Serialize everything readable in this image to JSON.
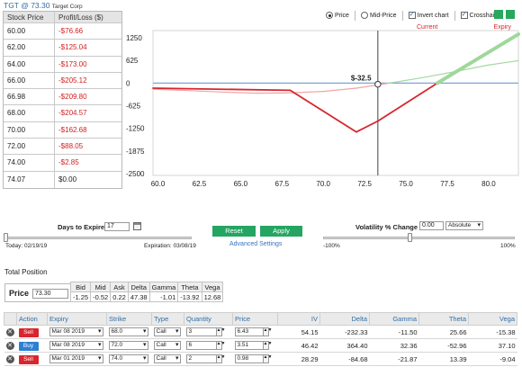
{
  "header": {
    "symbol": "TGT @ 73.30",
    "company": "Target Corp"
  },
  "pl_table": {
    "headers": [
      "Stock Price",
      "Profit/Loss ($)"
    ],
    "rows": [
      [
        "60.00",
        "-$76.66"
      ],
      [
        "62.00",
        "-$125.04"
      ],
      [
        "64.00",
        "-$173.00"
      ],
      [
        "66.00",
        "-$205.12"
      ],
      [
        "66.98",
        "-$209.80"
      ],
      [
        "68.00",
        "-$204.57"
      ],
      [
        "70.00",
        "-$162.68"
      ],
      [
        "72.00",
        "-$88.05"
      ],
      [
        "74.00",
        "-$2.85"
      ],
      [
        "74.07",
        "$0.00"
      ]
    ]
  },
  "options": {
    "price_label": "Price",
    "midprice_label": "Mid-Price",
    "invert_label": "Invert chart",
    "crosshairs_label": "Crosshairs",
    "price_selected": true,
    "invert_checked": true,
    "crosshairs_checked": true
  },
  "legend": {
    "current": "Current",
    "expiry": "Expiry"
  },
  "chart_data": {
    "type": "line",
    "x_ticks": [
      "60.0",
      "62.5",
      "65.0",
      "67.5",
      "70.0",
      "72.5",
      "75.0",
      "77.5",
      "80.0"
    ],
    "y_ticks": [
      "1250",
      "625",
      "0",
      "-625",
      "-1250",
      "-1875",
      "-2500"
    ],
    "xlim": [
      59.7,
      81.8
    ],
    "ylim": [
      -2550,
      1450
    ],
    "crosshair": {
      "x": 73.3,
      "y": -32.5,
      "label": "$-32.5"
    },
    "series": [
      {
        "name": "Current",
        "color": "#d7262e",
        "x": [
          59.7,
          62,
          64,
          66,
          68,
          70,
          72,
          74,
          76,
          78,
          80,
          81.8
        ],
        "y": [
          -170,
          -210,
          -250,
          -280,
          -270,
          -230,
          -140,
          0,
          150,
          320,
          500,
          620
        ]
      },
      {
        "name": "Expiry",
        "color": "#2a9f4b",
        "x": [
          59.7,
          68,
          72,
          73.3,
          76.9,
          81.8
        ],
        "y": [
          -140,
          -200,
          -1350,
          -1050,
          0,
          1350
        ]
      }
    ]
  },
  "days_to_expire": {
    "label": "Days to Expire",
    "value": "17",
    "today": "Today: 02/19/19",
    "expiration": "Expiration: 03/08/19"
  },
  "buttons": {
    "reset": "Reset",
    "apply": "Apply",
    "advanced": "Advanced Settings"
  },
  "volatility": {
    "label": "Volatility % Change",
    "value": "0.00",
    "mode": "Absolute",
    "min": "-100%",
    "max": "100%"
  },
  "total": {
    "title": "Total Position",
    "price_label": "Price",
    "price_value": "73.30",
    "greek_headers": [
      "Bid",
      "Mid",
      "Ask",
      "Delta",
      "Gamma",
      "Theta",
      "Vega"
    ],
    "greek_values": [
      "-1.25",
      "-0.52",
      "0.22",
      "47.38",
      "-1.01",
      "-13.92",
      "12.68"
    ]
  },
  "legs": {
    "headers": [
      "Action",
      "Expiry",
      "Strike",
      "Type",
      "Quantity",
      "Price",
      "IV",
      "Delta",
      "Gamma",
      "Theta",
      "Vega"
    ],
    "rows": [
      {
        "action": "Sell",
        "expiry": "Mar 08 2019",
        "strike": "68.0",
        "type": "Call",
        "qty": "3",
        "price": "6.43",
        "iv": "54.15",
        "delta": "-232.33",
        "gamma": "-11.50",
        "theta": "25.66",
        "vega": "-15.38"
      },
      {
        "action": "Buy",
        "expiry": "Mar 08 2019",
        "strike": "72.0",
        "type": "Call",
        "qty": "6",
        "price": "3.51",
        "iv": "46.42",
        "delta": "364.40",
        "gamma": "32.36",
        "theta": "-52.96",
        "vega": "37.10"
      },
      {
        "action": "Sell",
        "expiry": "Mar 01 2019",
        "strike": "74.0",
        "type": "Call",
        "qty": "2",
        "price": "0.98",
        "iv": "28.29",
        "delta": "-84.68",
        "gamma": "-21.87",
        "theta": "13.39",
        "vega": "-9.04"
      }
    ]
  }
}
